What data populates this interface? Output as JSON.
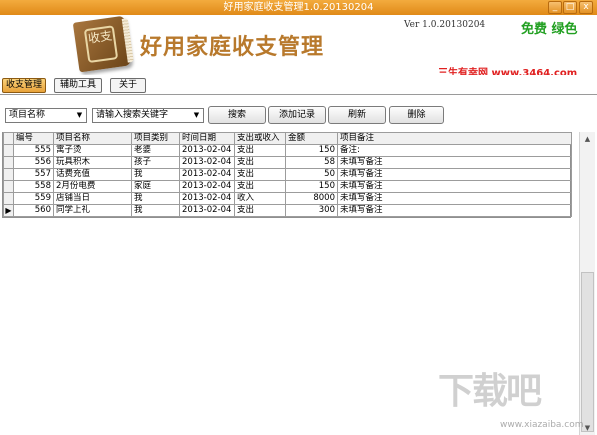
{
  "window": {
    "title": "好用家庭收支管理1.0.20130204",
    "minimize_glyph": "_",
    "maximize_glyph": "□",
    "close_glyph": "x"
  },
  "header": {
    "logo_text": "收支",
    "app_title": "好用家庭收支管理",
    "version": "Ver 1.0.20130204",
    "free_label": "免费 绿色",
    "site": "三生有幸网 www.3464.com"
  },
  "nav": {
    "items": [
      {
        "label": "收支管理",
        "active": true
      },
      {
        "label": "辅助工具",
        "active": false
      },
      {
        "label": "关于",
        "active": false
      }
    ]
  },
  "toolbar": {
    "field_select": "项目名称",
    "keyword_select": "请输入搜索关键字",
    "search_label": "搜索",
    "add_label": "添加记录",
    "refresh_label": "刷新",
    "delete_label": "删除"
  },
  "grid": {
    "columns": [
      "编号",
      "项目名称",
      "项目类别",
      "时间日期",
      "支出或收入",
      "金额",
      "项目备注"
    ],
    "current_row_marker": "▶",
    "rows": [
      {
        "id": "555",
        "name": "寓子烫",
        "category": "老婆",
        "date": "2013-02-04",
        "type": "支出",
        "amount": "150",
        "note": "备注:"
      },
      {
        "id": "556",
        "name": "玩具积木",
        "category": "孩子",
        "date": "2013-02-04",
        "type": "支出",
        "amount": "58",
        "note": "未填写备注"
      },
      {
        "id": "557",
        "name": "话费充值",
        "category": "我",
        "date": "2013-02-04",
        "type": "支出",
        "amount": "50",
        "note": "未填写备注"
      },
      {
        "id": "558",
        "name": "2月份电费",
        "category": "家庭",
        "date": "2013-02-04",
        "type": "支出",
        "amount": "150",
        "note": "未填写备注"
      },
      {
        "id": "559",
        "name": "店铺当日",
        "category": "我",
        "date": "2013-02-04",
        "type": "收入",
        "amount": "8000",
        "note": "未填写备注"
      },
      {
        "id": "560",
        "name": "同学上礼",
        "category": "我",
        "date": "2013-02-04",
        "type": "支出",
        "amount": "300",
        "note": "未填写备注"
      }
    ]
  },
  "watermark": {
    "text": "下载吧",
    "url": "www.xiazaiba.com"
  },
  "colors": {
    "titlebar": "#e99a28",
    "app_title": "#b8792c",
    "free_label": "#22a022",
    "site": "#e02020"
  }
}
